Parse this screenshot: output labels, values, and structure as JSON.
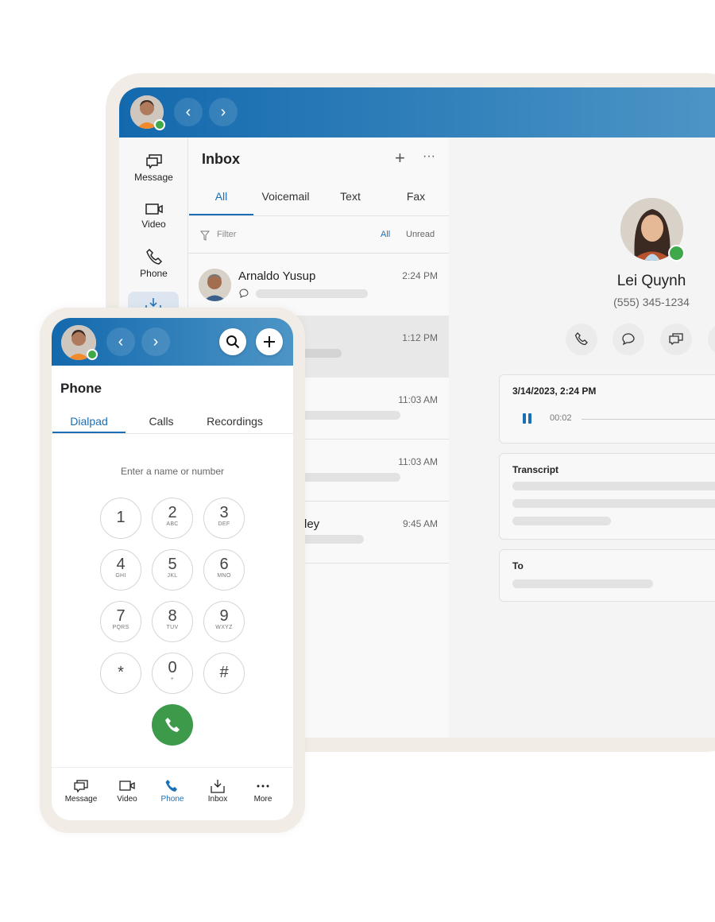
{
  "tablet": {
    "header": {
      "back": "‹",
      "forward": "›"
    },
    "sidebar": {
      "items": [
        {
          "label": "Message",
          "icon": "message-icon"
        },
        {
          "label": "Video",
          "icon": "video-icon"
        },
        {
          "label": "Phone",
          "icon": "phone-icon"
        },
        {
          "label": "",
          "icon": "inbox-icon",
          "active": true
        }
      ]
    },
    "inbox": {
      "title": "Inbox",
      "add": "+",
      "more": "···",
      "tabs": [
        {
          "label": "All",
          "active": true
        },
        {
          "label": "Voicemail"
        },
        {
          "label": "Text"
        },
        {
          "label": "Fax"
        }
      ],
      "filter": {
        "label": "Filter",
        "all": "All",
        "unread": "Unread"
      },
      "rows": [
        {
          "name": "Arnaldo Yusup",
          "time": "2:24 PM"
        },
        {
          "name": "",
          "time": "1:12 PM",
          "selected": true
        },
        {
          "name": "",
          "time": "11:03 AM"
        },
        {
          "name": "",
          "time": "11:03 AM"
        },
        {
          "name": "ley",
          "time": "9:45 AM"
        }
      ]
    },
    "detail": {
      "name": "Lei Quynh",
      "phone": "(555) 345-1234",
      "voicemail": {
        "date": "3/14/2023, 2:24 PM",
        "elapsed": "00:02"
      },
      "transcript_label": "Transcript",
      "to_label": "To"
    }
  },
  "phone": {
    "header": {
      "back": "‹",
      "forward": "›"
    },
    "title": "Phone",
    "tabs": [
      {
        "label": "Dialpad",
        "active": true
      },
      {
        "label": "Calls"
      },
      {
        "label": "Recordings"
      }
    ],
    "input_placeholder": "Enter a name or number",
    "keys": [
      {
        "d": "1",
        "l": ""
      },
      {
        "d": "2",
        "l": "ABC"
      },
      {
        "d": "3",
        "l": "DEF"
      },
      {
        "d": "4",
        "l": "GHI"
      },
      {
        "d": "5",
        "l": "JKL"
      },
      {
        "d": "6",
        "l": "MNO"
      },
      {
        "d": "7",
        "l": "PQRS"
      },
      {
        "d": "8",
        "l": "TUV"
      },
      {
        "d": "9",
        "l": "WXYZ"
      },
      {
        "d": "*",
        "l": ""
      },
      {
        "d": "0",
        "l": "+"
      },
      {
        "d": "#",
        "l": ""
      }
    ],
    "nav": [
      {
        "label": "Message"
      },
      {
        "label": "Video"
      },
      {
        "label": "Phone",
        "active": true
      },
      {
        "label": "Inbox"
      },
      {
        "label": "More"
      }
    ]
  },
  "colors": {
    "brand": "#1a6fb5",
    "online": "#3ea84a",
    "call": "#3d9a4a",
    "bezel": "#f1ece6"
  }
}
